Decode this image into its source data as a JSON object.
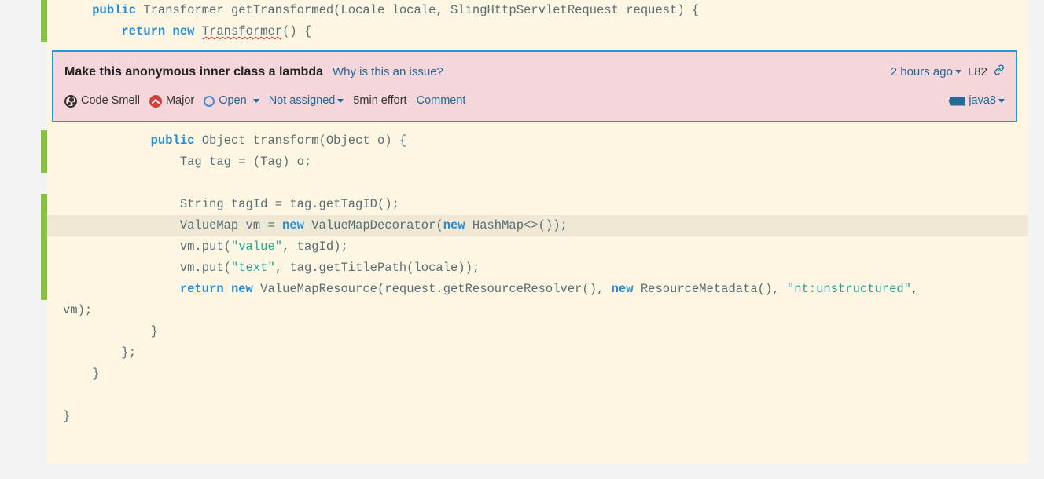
{
  "issue": {
    "title": "Make this anonymous inner class a lambda",
    "why_link": "Why is this an issue?",
    "age": "2 hours ago",
    "line_ref": "L82",
    "type": "Code Smell",
    "severity": "Major",
    "status": "Open",
    "assignee": "Not assigned",
    "effort": "5min effort",
    "comment_action": "Comment",
    "tag": "java8"
  },
  "code": {
    "l1": "    public Transformer getTransformed(Locale locale, SlingHttpServletRequest request) {",
    "l2_a": "        return new ",
    "l2_b": "Transformer",
    "l2_c": "() {",
    "l3": "",
    "l4": "            public Object transform(Object o) {",
    "l5": "                Tag tag = (Tag) o;",
    "l6": "",
    "l7": "                String tagId = tag.getTagID();",
    "l8_a": "                ValueMap vm = new ",
    "l8_b": "ValueMapDecorator(new ",
    "l8_c": "HashMap<>());",
    "l9_a": "                vm.put(",
    "l9_b": "\"value\"",
    "l9_c": ", tagId);",
    "l10_a": "                vm.put(",
    "l10_b": "\"text\"",
    "l10_c": ", tag.getTitlePath(locale));",
    "l11_a": "                return new ",
    "l11_b": "ValueMapResource(request.getResourceResolver(), new ",
    "l11_c": "ResourceMetadata(), ",
    "l11_d": "\"nt:unstructured\"",
    "l11_e": ",",
    "l12": "vm);",
    "l13": "            }",
    "l14": "        };",
    "l15": "    }",
    "l16": "",
    "l17": "}",
    "kw_public": "public",
    "kw_return": "return",
    "kw_new": "new"
  }
}
